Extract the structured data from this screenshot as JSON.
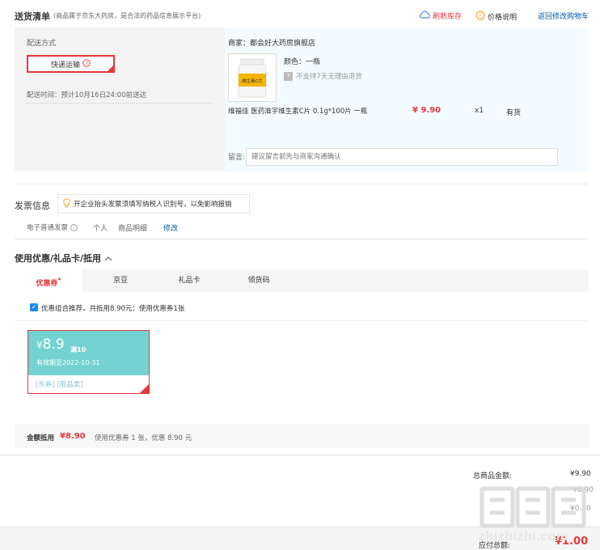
{
  "header": {
    "title": "送货清单",
    "subtitle": "(商品属于京东大药房，是合法的药品信息展示平台)",
    "refresh_stock": "刷新库存",
    "price_desc": "价格说明",
    "back_to_cart": "返回修改购物车"
  },
  "shipping": {
    "method_label": "配送方式",
    "express_label": "快递运输",
    "time_text": "配送时间：预计10月16日24:00前送达"
  },
  "product": {
    "seller": "商家：都会好大药房旗舰店",
    "color": "颜色：一瓶",
    "no_return": "不支持7天无理由退货",
    "no_return_badge": "7",
    "name": "维福佳 医药准字维生素C片 0.1g*100片 一瓶",
    "price": "¥ 9.90",
    "qty": "x1",
    "stock": "有货",
    "image_label": "维生素C片",
    "message_label": "留言:",
    "message_placeholder": "建议留言前先与商家沟通确认"
  },
  "invoice": {
    "title": "发票信息",
    "tip": "开企业抬头发票须填写纳税人识别号，以免影响报销",
    "type": "电子普通发票",
    "person": "个人",
    "detail": "商品明细",
    "edit": "修改"
  },
  "coupon": {
    "title": "使用优惠/礼品卡/抵用",
    "tabs": [
      "优惠券",
      "京豆",
      "礼品卡",
      "领货码"
    ],
    "tab_mark": "*",
    "recommend_text": "优惠组合推荐，共抵用8.90元：使用优惠券1张",
    "card": {
      "yen": "¥",
      "amount": "8.9",
      "condition": "满10",
      "expiry": "有效期至2022-10-31",
      "tags": "[东券] [限品类]"
    },
    "summary_label": "金额抵用",
    "summary_amount": "¥8.90",
    "summary_desc": "使用优惠券 1 张，优惠 8.90 元"
  },
  "totals": {
    "goods_label": "总商品金额:",
    "goods_value": "¥9.90",
    "row2_value": "-¥8.90",
    "row3_value": "¥0.00",
    "pay_label": "应付总额:",
    "pay_value": "¥1.00"
  },
  "watermark": "zhizhizhi.com",
  "colors": {
    "accent": "#e4393c",
    "link": "#005aa0",
    "coupon": "#74d2d2"
  }
}
